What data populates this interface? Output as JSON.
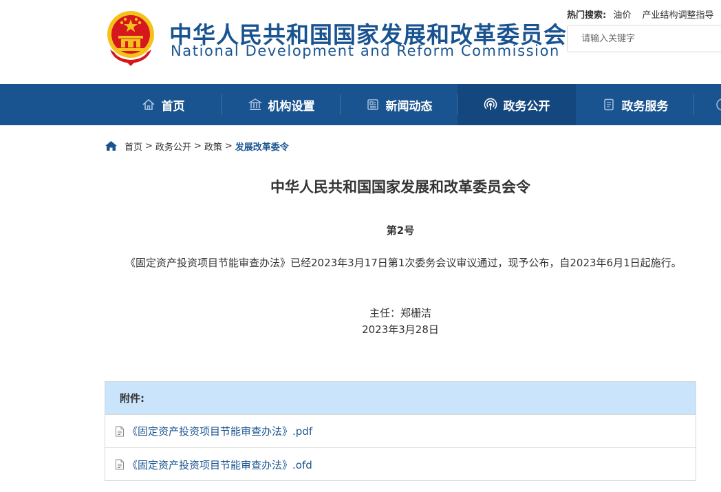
{
  "header": {
    "org_name_cn": "中华人民共和国国家发展和改革委员会",
    "org_name_en": "National Development and Reform Commission",
    "hot_label": "热门搜索:",
    "hot_links": [
      "油价",
      "产业结构调整指导"
    ],
    "search_placeholder": "请输入关键字"
  },
  "nav": {
    "items": [
      {
        "label": "首页",
        "icon": "home-icon"
      },
      {
        "label": "机构设置",
        "icon": "institution-icon"
      },
      {
        "label": "新闻动态",
        "icon": "news-icon"
      },
      {
        "label": "政务公开",
        "icon": "broadcast-icon",
        "active": true
      },
      {
        "label": "政务服务",
        "icon": "document-icon"
      }
    ]
  },
  "breadcrumb": {
    "items": [
      "首页",
      "政务公开",
      "政策"
    ],
    "current": "发展改革委令",
    "separator": ">"
  },
  "article": {
    "title": "中华人民共和国国家发展和改革委员会令",
    "order_no": "第2号",
    "body": "《固定资产投资项目节能审查办法》已经2023年3月17日第1次委务会议审议通过，现予公布，自2023年6月1日起施行。",
    "signer": "主任：郑栅洁",
    "date": "2023年3月28日"
  },
  "attachments": {
    "heading": "附件:",
    "files": [
      "《固定资产投资项目节能审查办法》.pdf",
      "《固定资产投资项目节能审查办法》.ofd"
    ]
  },
  "colors": {
    "brand_blue": "#1a5490",
    "nav_active": "#14477d",
    "attachment_header": "#c9e4fb",
    "emblem_red": "#d6181e",
    "emblem_gold": "#f5c21a"
  }
}
